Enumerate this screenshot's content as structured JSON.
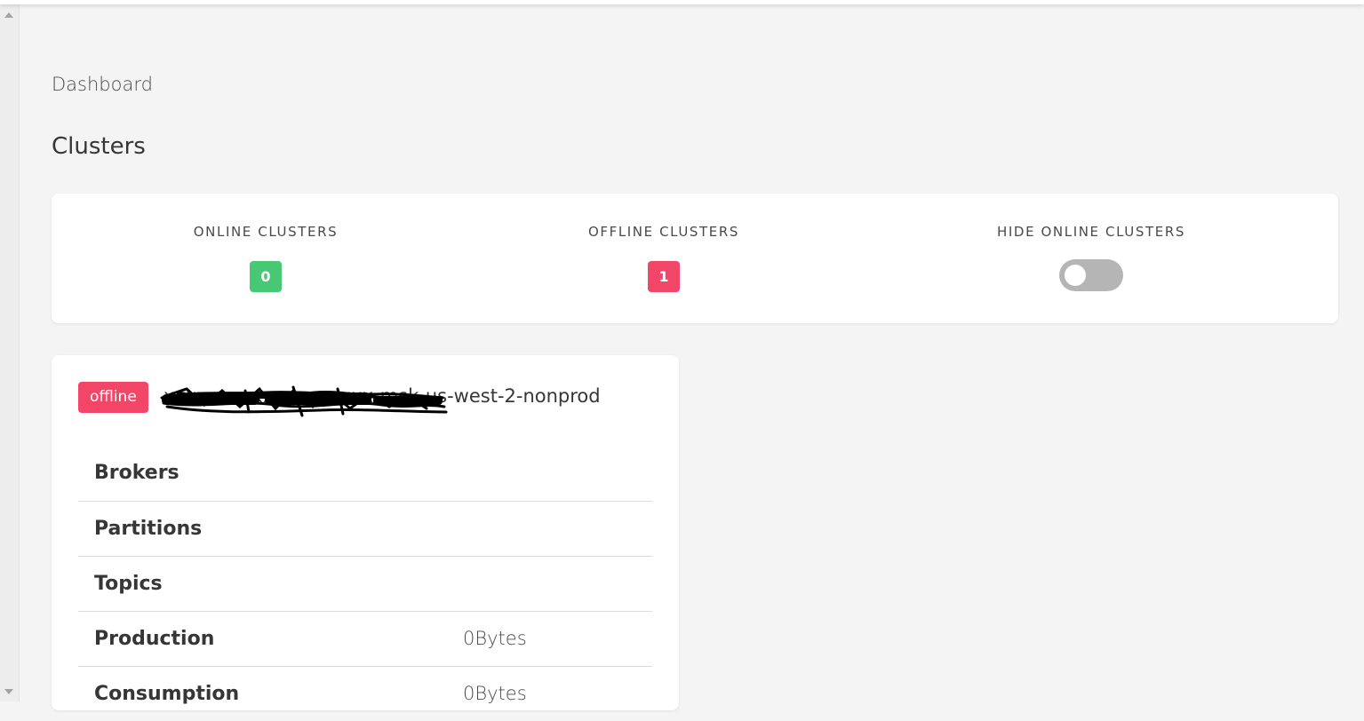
{
  "breadcrumb": "Dashboard",
  "page_title": "Clusters",
  "summary": {
    "online_label": "ONLINE CLUSTERS",
    "online_count": "0",
    "offline_label": "OFFLINE CLUSTERS",
    "offline_count": "1",
    "hide_online_label": "HIDE ONLINE CLUSTERS",
    "hide_online_enabled": false
  },
  "cluster": {
    "status": "offline",
    "name": "xxxxxxxxxxxxxxxxxxx-msk-us-west-2-nonprod",
    "metrics": [
      {
        "label": "Brokers",
        "value": ""
      },
      {
        "label": "Partitions",
        "value": ""
      },
      {
        "label": "Topics",
        "value": ""
      },
      {
        "label": "Production",
        "value": "0Bytes"
      },
      {
        "label": "Consumption",
        "value": "0Bytes"
      }
    ]
  },
  "colors": {
    "online": "#48c774",
    "offline": "#f14668",
    "toggle_off": "#b5b5b5"
  }
}
